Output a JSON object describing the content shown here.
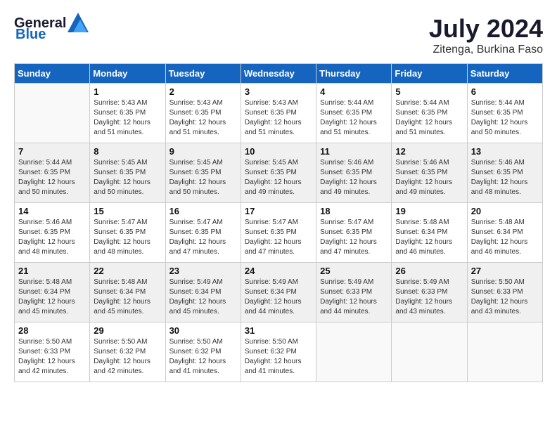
{
  "header": {
    "logo_general": "General",
    "logo_blue": "Blue",
    "month_year": "July 2024",
    "location": "Zitenga, Burkina Faso"
  },
  "days_of_week": [
    "Sunday",
    "Monday",
    "Tuesday",
    "Wednesday",
    "Thursday",
    "Friday",
    "Saturday"
  ],
  "weeks": [
    [
      {
        "day": "",
        "sunrise": "",
        "sunset": "",
        "daylight": ""
      },
      {
        "day": "1",
        "sunrise": "Sunrise: 5:43 AM",
        "sunset": "Sunset: 6:35 PM",
        "daylight": "Daylight: 12 hours and 51 minutes."
      },
      {
        "day": "2",
        "sunrise": "Sunrise: 5:43 AM",
        "sunset": "Sunset: 6:35 PM",
        "daylight": "Daylight: 12 hours and 51 minutes."
      },
      {
        "day": "3",
        "sunrise": "Sunrise: 5:43 AM",
        "sunset": "Sunset: 6:35 PM",
        "daylight": "Daylight: 12 hours and 51 minutes."
      },
      {
        "day": "4",
        "sunrise": "Sunrise: 5:44 AM",
        "sunset": "Sunset: 6:35 PM",
        "daylight": "Daylight: 12 hours and 51 minutes."
      },
      {
        "day": "5",
        "sunrise": "Sunrise: 5:44 AM",
        "sunset": "Sunset: 6:35 PM",
        "daylight": "Daylight: 12 hours and 51 minutes."
      },
      {
        "day": "6",
        "sunrise": "Sunrise: 5:44 AM",
        "sunset": "Sunset: 6:35 PM",
        "daylight": "Daylight: 12 hours and 50 minutes."
      }
    ],
    [
      {
        "day": "7",
        "sunrise": "Sunrise: 5:44 AM",
        "sunset": "Sunset: 6:35 PM",
        "daylight": "Daylight: 12 hours and 50 minutes."
      },
      {
        "day": "8",
        "sunrise": "Sunrise: 5:45 AM",
        "sunset": "Sunset: 6:35 PM",
        "daylight": "Daylight: 12 hours and 50 minutes."
      },
      {
        "day": "9",
        "sunrise": "Sunrise: 5:45 AM",
        "sunset": "Sunset: 6:35 PM",
        "daylight": "Daylight: 12 hours and 50 minutes."
      },
      {
        "day": "10",
        "sunrise": "Sunrise: 5:45 AM",
        "sunset": "Sunset: 6:35 PM",
        "daylight": "Daylight: 12 hours and 49 minutes."
      },
      {
        "day": "11",
        "sunrise": "Sunrise: 5:46 AM",
        "sunset": "Sunset: 6:35 PM",
        "daylight": "Daylight: 12 hours and 49 minutes."
      },
      {
        "day": "12",
        "sunrise": "Sunrise: 5:46 AM",
        "sunset": "Sunset: 6:35 PM",
        "daylight": "Daylight: 12 hours and 49 minutes."
      },
      {
        "day": "13",
        "sunrise": "Sunrise: 5:46 AM",
        "sunset": "Sunset: 6:35 PM",
        "daylight": "Daylight: 12 hours and 48 minutes."
      }
    ],
    [
      {
        "day": "14",
        "sunrise": "Sunrise: 5:46 AM",
        "sunset": "Sunset: 6:35 PM",
        "daylight": "Daylight: 12 hours and 48 minutes."
      },
      {
        "day": "15",
        "sunrise": "Sunrise: 5:47 AM",
        "sunset": "Sunset: 6:35 PM",
        "daylight": "Daylight: 12 hours and 48 minutes."
      },
      {
        "day": "16",
        "sunrise": "Sunrise: 5:47 AM",
        "sunset": "Sunset: 6:35 PM",
        "daylight": "Daylight: 12 hours and 47 minutes."
      },
      {
        "day": "17",
        "sunrise": "Sunrise: 5:47 AM",
        "sunset": "Sunset: 6:35 PM",
        "daylight": "Daylight: 12 hours and 47 minutes."
      },
      {
        "day": "18",
        "sunrise": "Sunrise: 5:47 AM",
        "sunset": "Sunset: 6:35 PM",
        "daylight": "Daylight: 12 hours and 47 minutes."
      },
      {
        "day": "19",
        "sunrise": "Sunrise: 5:48 AM",
        "sunset": "Sunset: 6:34 PM",
        "daylight": "Daylight: 12 hours and 46 minutes."
      },
      {
        "day": "20",
        "sunrise": "Sunrise: 5:48 AM",
        "sunset": "Sunset: 6:34 PM",
        "daylight": "Daylight: 12 hours and 46 minutes."
      }
    ],
    [
      {
        "day": "21",
        "sunrise": "Sunrise: 5:48 AM",
        "sunset": "Sunset: 6:34 PM",
        "daylight": "Daylight: 12 hours and 45 minutes."
      },
      {
        "day": "22",
        "sunrise": "Sunrise: 5:48 AM",
        "sunset": "Sunset: 6:34 PM",
        "daylight": "Daylight: 12 hours and 45 minutes."
      },
      {
        "day": "23",
        "sunrise": "Sunrise: 5:49 AM",
        "sunset": "Sunset: 6:34 PM",
        "daylight": "Daylight: 12 hours and 45 minutes."
      },
      {
        "day": "24",
        "sunrise": "Sunrise: 5:49 AM",
        "sunset": "Sunset: 6:34 PM",
        "daylight": "Daylight: 12 hours and 44 minutes."
      },
      {
        "day": "25",
        "sunrise": "Sunrise: 5:49 AM",
        "sunset": "Sunset: 6:33 PM",
        "daylight": "Daylight: 12 hours and 44 minutes."
      },
      {
        "day": "26",
        "sunrise": "Sunrise: 5:49 AM",
        "sunset": "Sunset: 6:33 PM",
        "daylight": "Daylight: 12 hours and 43 minutes."
      },
      {
        "day": "27",
        "sunrise": "Sunrise: 5:50 AM",
        "sunset": "Sunset: 6:33 PM",
        "daylight": "Daylight: 12 hours and 43 minutes."
      }
    ],
    [
      {
        "day": "28",
        "sunrise": "Sunrise: 5:50 AM",
        "sunset": "Sunset: 6:33 PM",
        "daylight": "Daylight: 12 hours and 42 minutes."
      },
      {
        "day": "29",
        "sunrise": "Sunrise: 5:50 AM",
        "sunset": "Sunset: 6:32 PM",
        "daylight": "Daylight: 12 hours and 42 minutes."
      },
      {
        "day": "30",
        "sunrise": "Sunrise: 5:50 AM",
        "sunset": "Sunset: 6:32 PM",
        "daylight": "Daylight: 12 hours and 41 minutes."
      },
      {
        "day": "31",
        "sunrise": "Sunrise: 5:50 AM",
        "sunset": "Sunset: 6:32 PM",
        "daylight": "Daylight: 12 hours and 41 minutes."
      },
      {
        "day": "",
        "sunrise": "",
        "sunset": "",
        "daylight": ""
      },
      {
        "day": "",
        "sunrise": "",
        "sunset": "",
        "daylight": ""
      },
      {
        "day": "",
        "sunrise": "",
        "sunset": "",
        "daylight": ""
      }
    ]
  ]
}
